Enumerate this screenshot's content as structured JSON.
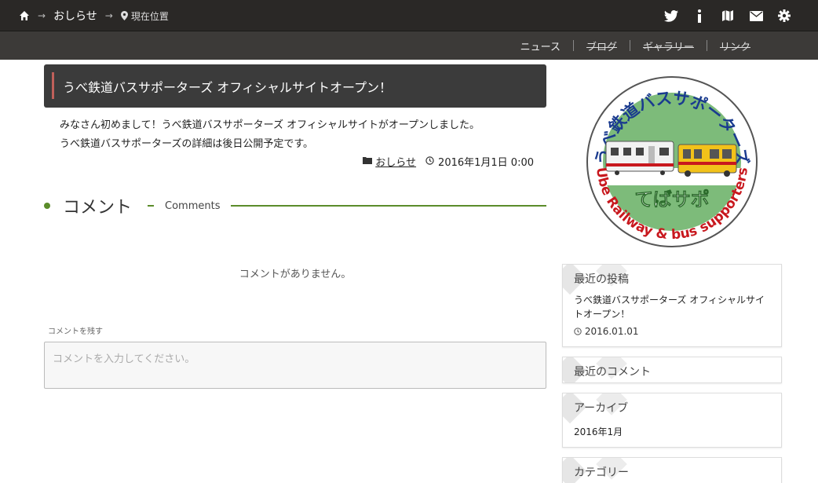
{
  "breadcrumb": {
    "parent": "おしらせ",
    "current": "現在位置"
  },
  "top_icons": [
    "home-icon",
    "twitter-icon",
    "info-icon",
    "map-icon",
    "mail-icon",
    "gear-icon"
  ],
  "nav": {
    "items": [
      {
        "label": "ニュース",
        "struck": false
      },
      {
        "label": "ブログ",
        "struck": true
      },
      {
        "label": "ギャラリー",
        "struck": true
      },
      {
        "label": "リンク",
        "struck": true
      }
    ]
  },
  "post": {
    "title": "うべ鉄道バスサポーターズ オフィシャルサイトオープン！",
    "body_line1": "みなさん初めまして！うべ鉄道バスサポーターズ オフィシャルサイトがオープンしました。",
    "body_line2": "うべ鉄道バスサポーターズの詳細は後日公開予定です。",
    "category": "おしらせ",
    "datetime": "2016年1月1日 0:00"
  },
  "comments": {
    "heading": "コメント",
    "heading_en": "Comments",
    "none_text": "コメントがありません。",
    "leave_label": "コメントを残す",
    "placeholder": "コメントを入力してください。"
  },
  "logo": {
    "arc_top": "うべ鉄道バスサポーターズ",
    "center": "てばサポ",
    "arc_bottom": "Ube Railway & bus supporters"
  },
  "sidebar": {
    "recent_posts": {
      "title": "最近の投稿",
      "item": "うべ鉄道バスサポーターズ オフィシャルサイトオープン！",
      "date": "2016.01.01"
    },
    "recent_comments": {
      "title": "最近のコメント"
    },
    "archives": {
      "title": "アーカイブ",
      "item": "2016年1月"
    },
    "categories": {
      "title": "カテゴリー"
    }
  },
  "colors": {
    "topbar": "#2a2826",
    "navbar": "#3c3a38",
    "title_bg": "#3b3b3b",
    "accent_green": "#5b8c2a",
    "title_mark": "#c0605a",
    "logo_green": "#7dbb7a",
    "logo_blue": "#1a3b8f",
    "logo_red": "#c8181e"
  }
}
